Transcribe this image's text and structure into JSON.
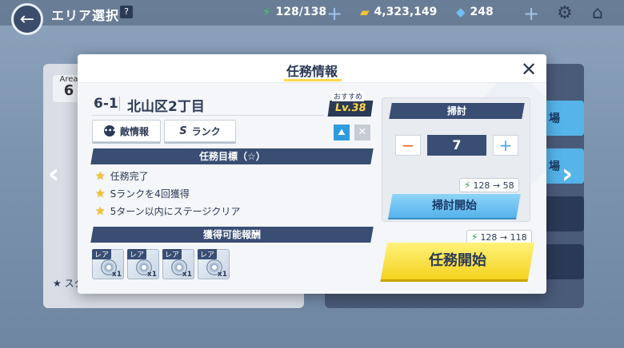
{
  "topbar": {
    "title": "エリア選択",
    "help": "?",
    "ap": "128/138",
    "credits": "4,323,149",
    "gems": "248"
  },
  "background": {
    "area_label": "Area",
    "area_number": "6",
    "side_buttons": [
      "場",
      "場"
    ],
    "star_row_text": "スタ"
  },
  "modal": {
    "title": "任務情報",
    "stage_number": "6-1",
    "stage_name": "北山区2丁目",
    "recommended_label": "おすすめ",
    "recommended_level": "Lv.38",
    "tabs": {
      "enemy_info": "敵情報",
      "rank_prefix": "S",
      "rank_label": "ランク"
    },
    "objectives_header": "任務目標（☆）",
    "objectives": [
      "任務完了",
      "Sランクを4回獲得",
      "5ターン以内にステージクリア"
    ],
    "rewards_header": "獲得可能報酬",
    "rewards": [
      {
        "tag": "レア",
        "count": "x1"
      },
      {
        "tag": "レア",
        "count": "x1"
      },
      {
        "tag": "レア",
        "count": "x1"
      },
      {
        "tag": "レア",
        "count": "x1"
      }
    ],
    "sweep": {
      "header": "掃討",
      "count": "7",
      "minus": "−",
      "plus": "+",
      "cost": "128 → 58",
      "button": "掃討開始"
    },
    "mission": {
      "cost": "128 → 118",
      "button": "任務開始"
    },
    "close": "✕"
  }
}
